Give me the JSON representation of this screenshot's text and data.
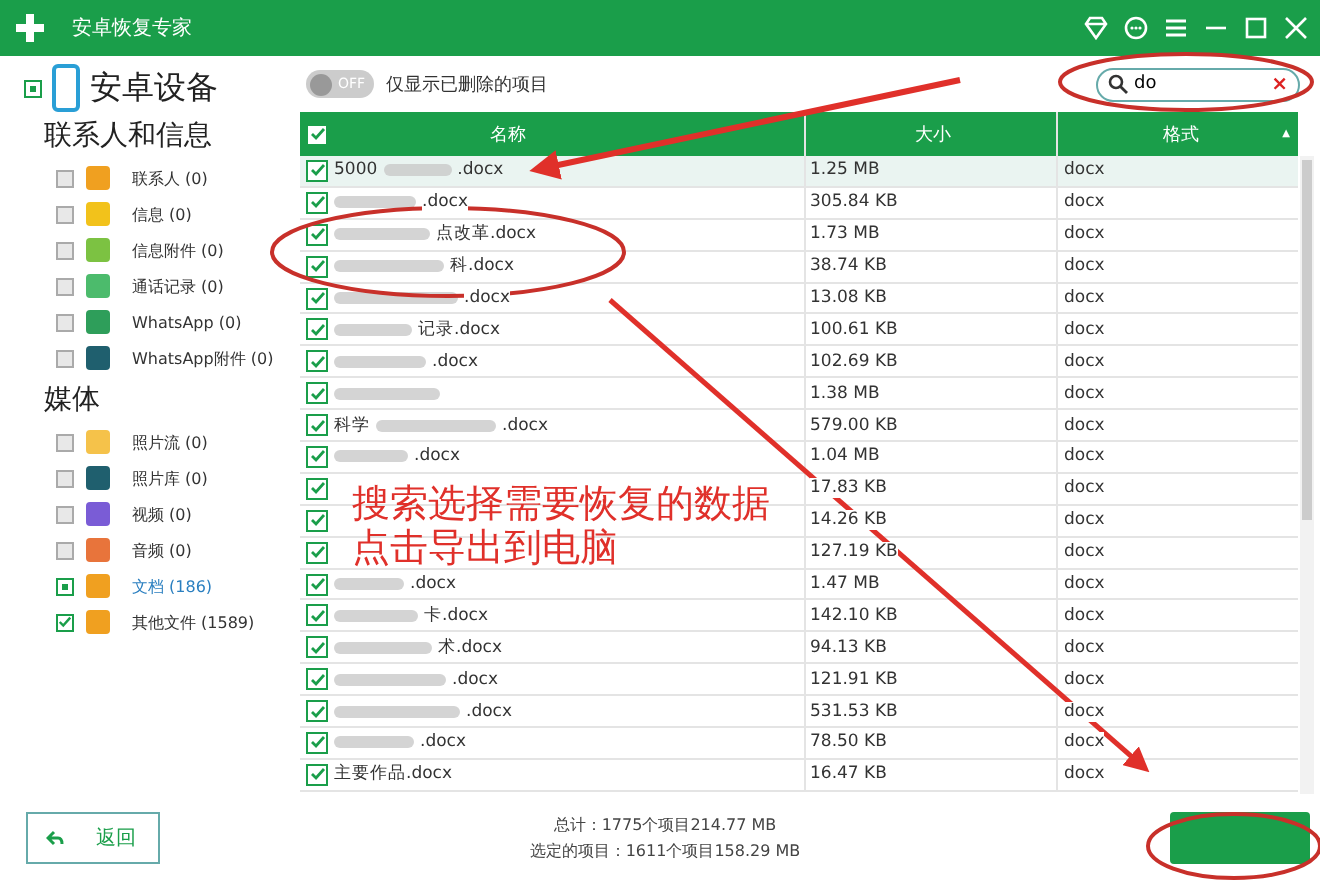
{
  "window": {
    "title": "安卓恢复专家"
  },
  "sidebar": {
    "device": {
      "label": "安卓设备",
      "partial": true
    },
    "groups": [
      {
        "title": "联系人和信息",
        "items": [
          {
            "label": "联系人 (0)",
            "checked": false,
            "partial": false,
            "color": "#f0a020"
          },
          {
            "label": "信息 (0)",
            "checked": false,
            "partial": false,
            "color": "#f2c21b"
          },
          {
            "label": "信息附件 (0)",
            "checked": false,
            "partial": false,
            "color": "#7cc242"
          },
          {
            "label": "通话记录 (0)",
            "checked": false,
            "partial": false,
            "color": "#4cbb6c"
          },
          {
            "label": "WhatsApp (0)",
            "checked": false,
            "partial": false,
            "color": "#2e9e5a"
          },
          {
            "label": "WhatsApp附件 (0)",
            "checked": false,
            "partial": false,
            "color": "#1f5f6e"
          }
        ]
      },
      {
        "title": "媒体",
        "items": [
          {
            "label": "照片流 (0)",
            "checked": false,
            "partial": false,
            "color": "#f5c24a"
          },
          {
            "label": "照片库 (0)",
            "checked": false,
            "partial": false,
            "color": "#1f5f6e"
          },
          {
            "label": "视频 (0)",
            "checked": false,
            "partial": false,
            "color": "#7a5cd6"
          },
          {
            "label": "音频 (0)",
            "checked": false,
            "partial": false,
            "color": "#e8743b"
          },
          {
            "label": "文档 (186)",
            "checked": false,
            "partial": true,
            "selected": true,
            "color": "#f0a020"
          },
          {
            "label": "其他文件 (1589)",
            "checked": true,
            "partial": false,
            "selected": false,
            "color": "#f0a020"
          }
        ]
      }
    ]
  },
  "toggle": {
    "label": "OFF",
    "on": false,
    "text": "仅显示已删除的项目"
  },
  "search": {
    "value": "do",
    "clear": "×"
  },
  "table": {
    "columns": [
      "名称",
      "大小",
      "格式"
    ],
    "all_checked": true,
    "sort_mark": "▲",
    "rows": [
      {
        "start": "5000",
        "end": ".docx",
        "checked": true,
        "selected": true,
        "size": "1.25 MB",
        "format": "docx"
      },
      {
        "start": "",
        "end": ".docx",
        "checked": true,
        "selected": false,
        "size": "305.84 KB",
        "format": "docx"
      },
      {
        "start": "",
        "end": "点改革.docx",
        "checked": true,
        "selected": false,
        "size": "1.73 MB",
        "format": "docx"
      },
      {
        "start": "",
        "end": "科.docx",
        "checked": true,
        "selected": false,
        "size": "38.74 KB",
        "format": "docx"
      },
      {
        "start": "",
        "end": ".docx",
        "checked": true,
        "selected": false,
        "size": "13.08 KB",
        "format": "docx"
      },
      {
        "start": "",
        "end": "记录.docx",
        "checked": true,
        "selected": false,
        "size": "100.61 KB",
        "format": "docx"
      },
      {
        "start": "",
        "end": ".docx",
        "checked": true,
        "selected": false,
        "size": "102.69 KB",
        "format": "docx"
      },
      {
        "start": "",
        "end": "",
        "checked": true,
        "selected": false,
        "size": "1.38 MB",
        "format": "docx"
      },
      {
        "start": "科学",
        "end": ".docx",
        "checked": true,
        "selected": false,
        "size": "579.00 KB",
        "format": "docx"
      },
      {
        "start": "",
        "end": ".docx",
        "checked": true,
        "selected": false,
        "size": "1.04 MB",
        "format": "docx"
      },
      {
        "start": "",
        "end": "",
        "checked": true,
        "selected": false,
        "size": "17.83 KB",
        "format": "docx"
      },
      {
        "start": "",
        "end": "",
        "checked": true,
        "selected": false,
        "size": "14.26 KB",
        "format": "docx"
      },
      {
        "start": "",
        "end": "",
        "checked": true,
        "selected": false,
        "size": "127.19 KB",
        "format": "docx"
      },
      {
        "start": "",
        "end": ".docx",
        "checked": true,
        "selected": false,
        "size": "1.47 MB",
        "format": "docx"
      },
      {
        "start": "",
        "end": "卡.docx",
        "checked": true,
        "selected": false,
        "size": "142.10 KB",
        "format": "docx"
      },
      {
        "start": "",
        "end": "术.docx",
        "checked": true,
        "selected": false,
        "size": "94.13 KB",
        "format": "docx"
      },
      {
        "start": "",
        "end": ".docx",
        "checked": true,
        "selected": false,
        "size": "121.91 KB",
        "format": "docx"
      },
      {
        "start": "",
        "end": ".docx",
        "checked": true,
        "selected": false,
        "size": "531.53 KB",
        "format": "docx"
      },
      {
        "start": "",
        "end": ".docx",
        "checked": true,
        "selected": false,
        "size": "78.50 KB",
        "format": "docx"
      },
      {
        "start": "主要作品.docx",
        "end": "",
        "checked": true,
        "selected": false,
        "size": "16.47 KB",
        "format": "docx"
      }
    ]
  },
  "footer": {
    "back": "返回",
    "total": "总计：1775个项目214.77 MB",
    "selected_total": "选定的项目：1611个项目158.29 MB"
  },
  "annotation": {
    "lines": [
      "搜索选择需要恢复的数据",
      "点击导出到电脑"
    ]
  }
}
